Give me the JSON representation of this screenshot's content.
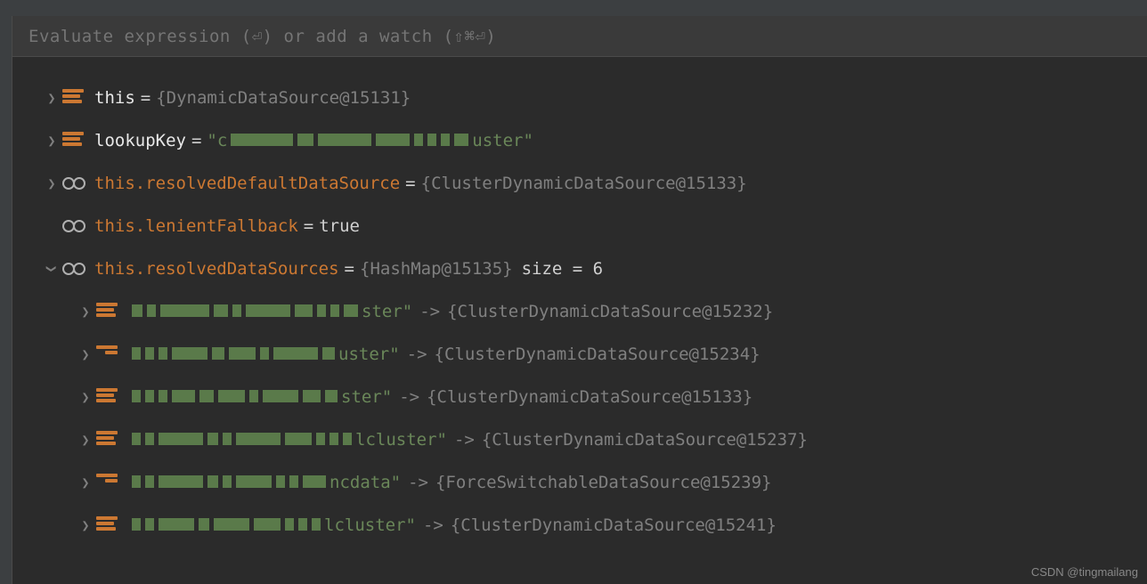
{
  "expression_bar": {
    "placeholder": "Evaluate expression (⏎) or add a watch (⇧⌘⏎)"
  },
  "variables": [
    {
      "name": "this",
      "value": "{DynamicDataSource@15131}",
      "icon": "object",
      "arrow": "collapsed",
      "name_class": "normal",
      "value_class": "gray"
    },
    {
      "name": "lookupKey",
      "value_prefix": "\"c",
      "value_suffix": "uster\"",
      "icon": "object",
      "arrow": "collapsed",
      "name_class": "normal",
      "value_class": "green",
      "blurred": true
    },
    {
      "name": "this.resolvedDefaultDataSource",
      "value": "{ClusterDynamicDataSource@15133}",
      "icon": "glasses",
      "arrow": "collapsed",
      "name_class": "watch",
      "value_class": "gray"
    },
    {
      "name": "this.lenientFallback",
      "value": "true",
      "icon": "glasses",
      "arrow": "none",
      "name_class": "watch",
      "value_class": "white"
    },
    {
      "name": "this.resolvedDataSources",
      "value": "{HashMap@15135}",
      "size": "size = 6",
      "icon": "glasses",
      "arrow": "expanded",
      "name_class": "watch",
      "value_class": "gray"
    }
  ],
  "map_entries": [
    {
      "key_suffix": "ster\"",
      "value": "{ClusterDynamicDataSource@15232}",
      "icon_variant": "a"
    },
    {
      "key_suffix": "uster\"",
      "value": "{ClusterDynamicDataSource@15234}",
      "icon_variant": "b"
    },
    {
      "key_suffix": "ster\"",
      "value": "{ClusterDynamicDataSource@15133}",
      "icon_variant": "a"
    },
    {
      "key_suffix": "lcluster\"",
      "value": "{ClusterDynamicDataSource@15237}",
      "icon_variant": "a"
    },
    {
      "key_suffix": "ncdata\"",
      "value": "{ForceSwitchableDataSource@15239}",
      "icon_variant": "b"
    },
    {
      "key_suffix": "lcluster\"",
      "value": "{ClusterDynamicDataSource@15241}",
      "icon_variant": "a"
    }
  ],
  "watermark": "CSDN @tingmailang"
}
